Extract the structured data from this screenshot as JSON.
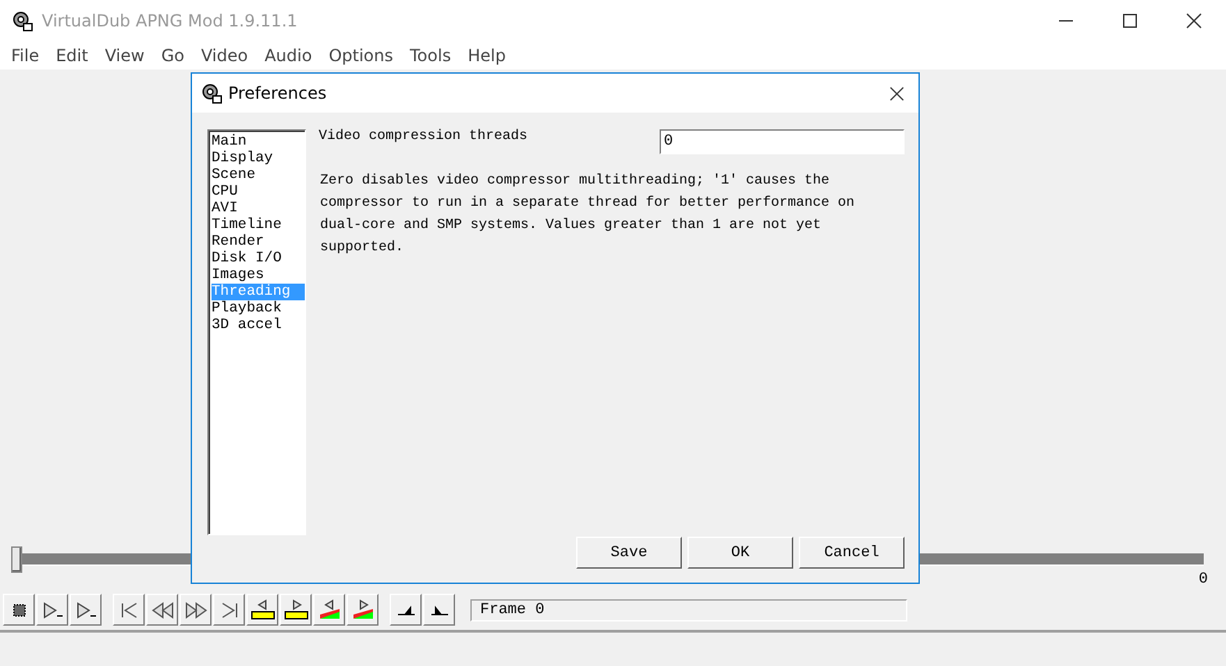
{
  "window": {
    "title": "VirtualDub APNG Mod 1.9.11.1"
  },
  "menu": [
    "File",
    "Edit",
    "View",
    "Go",
    "Video",
    "Audio",
    "Options",
    "Tools",
    "Help"
  ],
  "dialog": {
    "title": "Preferences",
    "categories": [
      {
        "label": "Main",
        "selected": false
      },
      {
        "label": "Display",
        "selected": false
      },
      {
        "label": "Scene",
        "selected": false
      },
      {
        "label": "CPU",
        "selected": false
      },
      {
        "label": "AVI",
        "selected": false
      },
      {
        "label": "Timeline",
        "selected": false
      },
      {
        "label": "Render",
        "selected": false
      },
      {
        "label": "Disk I/O",
        "selected": false
      },
      {
        "label": "Images",
        "selected": false
      },
      {
        "label": "Threading",
        "selected": true
      },
      {
        "label": "Playback",
        "selected": false
      },
      {
        "label": "3D accel",
        "selected": false
      }
    ],
    "setting": {
      "label": "Video compression threads",
      "value": "0"
    },
    "description": "Zero disables video compressor multithreading; '1' causes the compressor to run in a separate thread for better performance on dual-core and SMP systems. Values greater than 1 are not yet supported.",
    "buttons": [
      "Save",
      "OK",
      "Cancel"
    ]
  },
  "position_slider": {
    "level": 0,
    "tick": "0"
  },
  "frame_field": "Frame 0"
}
